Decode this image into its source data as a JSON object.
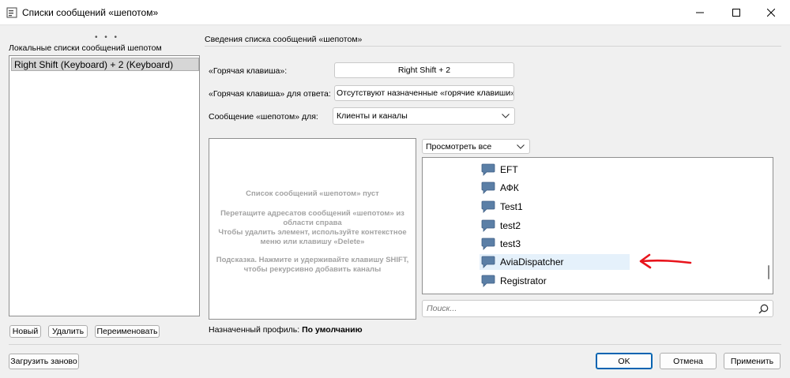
{
  "window": {
    "title": "Списки сообщений «шепотом»"
  },
  "left_panel": {
    "header": "Локальные списки сообщений шепотом",
    "items": [
      "Right Shift (Keyboard) + 2 (Keyboard)"
    ],
    "buttons": {
      "new": "Новый",
      "delete": "Удалить",
      "rename": "Переименовать"
    }
  },
  "right_panel": {
    "header": "Сведения списка сообщений «шепотом»",
    "hotkey_label": "«Горячая клавиша»:",
    "hotkey_value": "Right Shift + 2",
    "reply_hotkey_label": "«Горячая клавиша» для ответа:",
    "reply_hotkey_value": "Отсутствуют назначенные «горячие клавиши»",
    "whisper_for_label": "Сообщение «шепотом» для:",
    "whisper_for_value": "Клиенты и каналы",
    "empty_list": {
      "line1": "Список сообщений «шепотом» пуст",
      "line2": "Перетащите адресатов сообщений «шепотом» из области справа",
      "line3": "Чтобы удалить элемент, используйте контекстное меню или клавишу «Delete»",
      "line4": "Подсказка. Нажмите и удерживайте клавишу SHIFT, чтобы рекурсивно добавить каналы"
    },
    "view_filter": "Просмотреть все",
    "channels": [
      {
        "name": "EFT",
        "selected": false
      },
      {
        "name": "АФК",
        "selected": false
      },
      {
        "name": "Test1",
        "selected": false
      },
      {
        "name": "test2",
        "selected": false
      },
      {
        "name": "test3",
        "selected": false
      },
      {
        "name": "AviaDispatcher",
        "selected": true
      },
      {
        "name": "Registrator",
        "selected": false
      }
    ],
    "search_placeholder": "Поиск...",
    "assigned_profile_label": "Назначенный профиль:",
    "assigned_profile_value": "По умолчанию"
  },
  "footer": {
    "reload": "Загрузить заново",
    "ok": "OK",
    "cancel": "Отмена",
    "apply": "Применить"
  },
  "colors": {
    "annotation_arrow": "#e8141c",
    "primary_border": "#0063b1",
    "channel_icon": "#5b7fa6"
  }
}
